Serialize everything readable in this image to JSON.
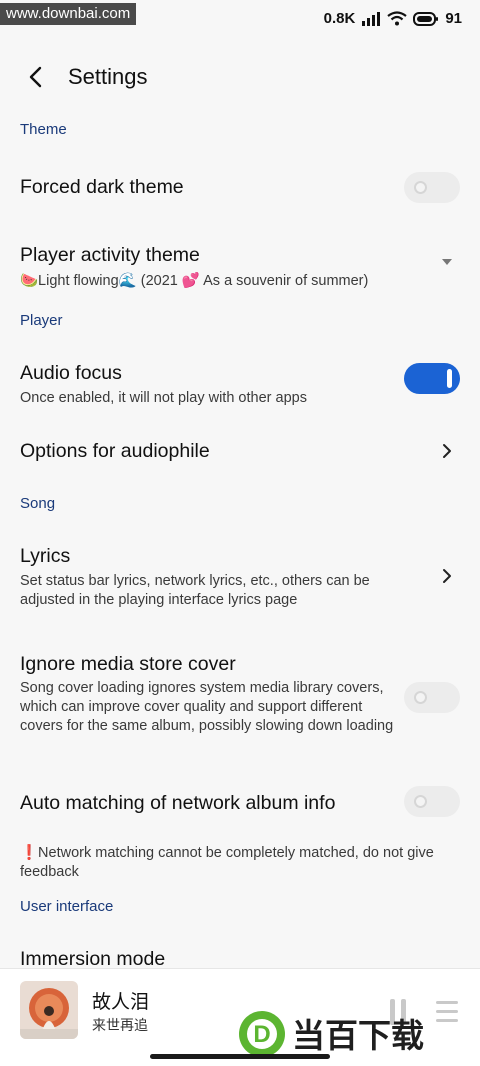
{
  "status_bar": {
    "watermark": "www.downbai.com",
    "network_speed": "0.8K",
    "network_unit": "K/s",
    "battery": "91"
  },
  "header": {
    "title": "Settings",
    "back_icon": "back-arrow-icon"
  },
  "sections": {
    "theme": "Theme",
    "player": "Player",
    "song": "Song",
    "user_interface": "User interface"
  },
  "settings": {
    "forced_dark_theme": {
      "title": "Forced dark theme",
      "enabled": false
    },
    "player_activity_theme": {
      "title": "Player activity theme",
      "value": "🍉Light flowing🌊 (2021 💕 As a souvenir of summer)"
    },
    "audio_focus": {
      "title": "Audio focus",
      "description": "Once enabled, it will not play with other apps",
      "enabled": true
    },
    "options_audiophile": {
      "title": "Options for audiophile"
    },
    "lyrics": {
      "title": "Lyrics",
      "description": "Set status bar lyrics, network lyrics, etc., others can be adjusted in the playing interface lyrics page"
    },
    "ignore_media_store_cover": {
      "title": "Ignore media store cover",
      "description": "Song cover loading ignores system media library covers, which can improve cover quality and support different covers for the same album, possibly slowing down loading",
      "enabled": false
    },
    "auto_matching_album_info": {
      "title": "Auto matching of network album info",
      "enabled": false
    },
    "network_matching_note": "❗Network matching cannot be completely matched, do not give feedback",
    "immersion_mode": {
      "title": "Immersion mode"
    }
  },
  "mini_player": {
    "song_title": "故人泪",
    "artist": "来世再追",
    "brand_text": "当百下载",
    "brand_letter": "D"
  },
  "colors": {
    "accent": "#1b63d4",
    "section_header": "#1a3a7a",
    "brand_green": "#5cb531"
  }
}
